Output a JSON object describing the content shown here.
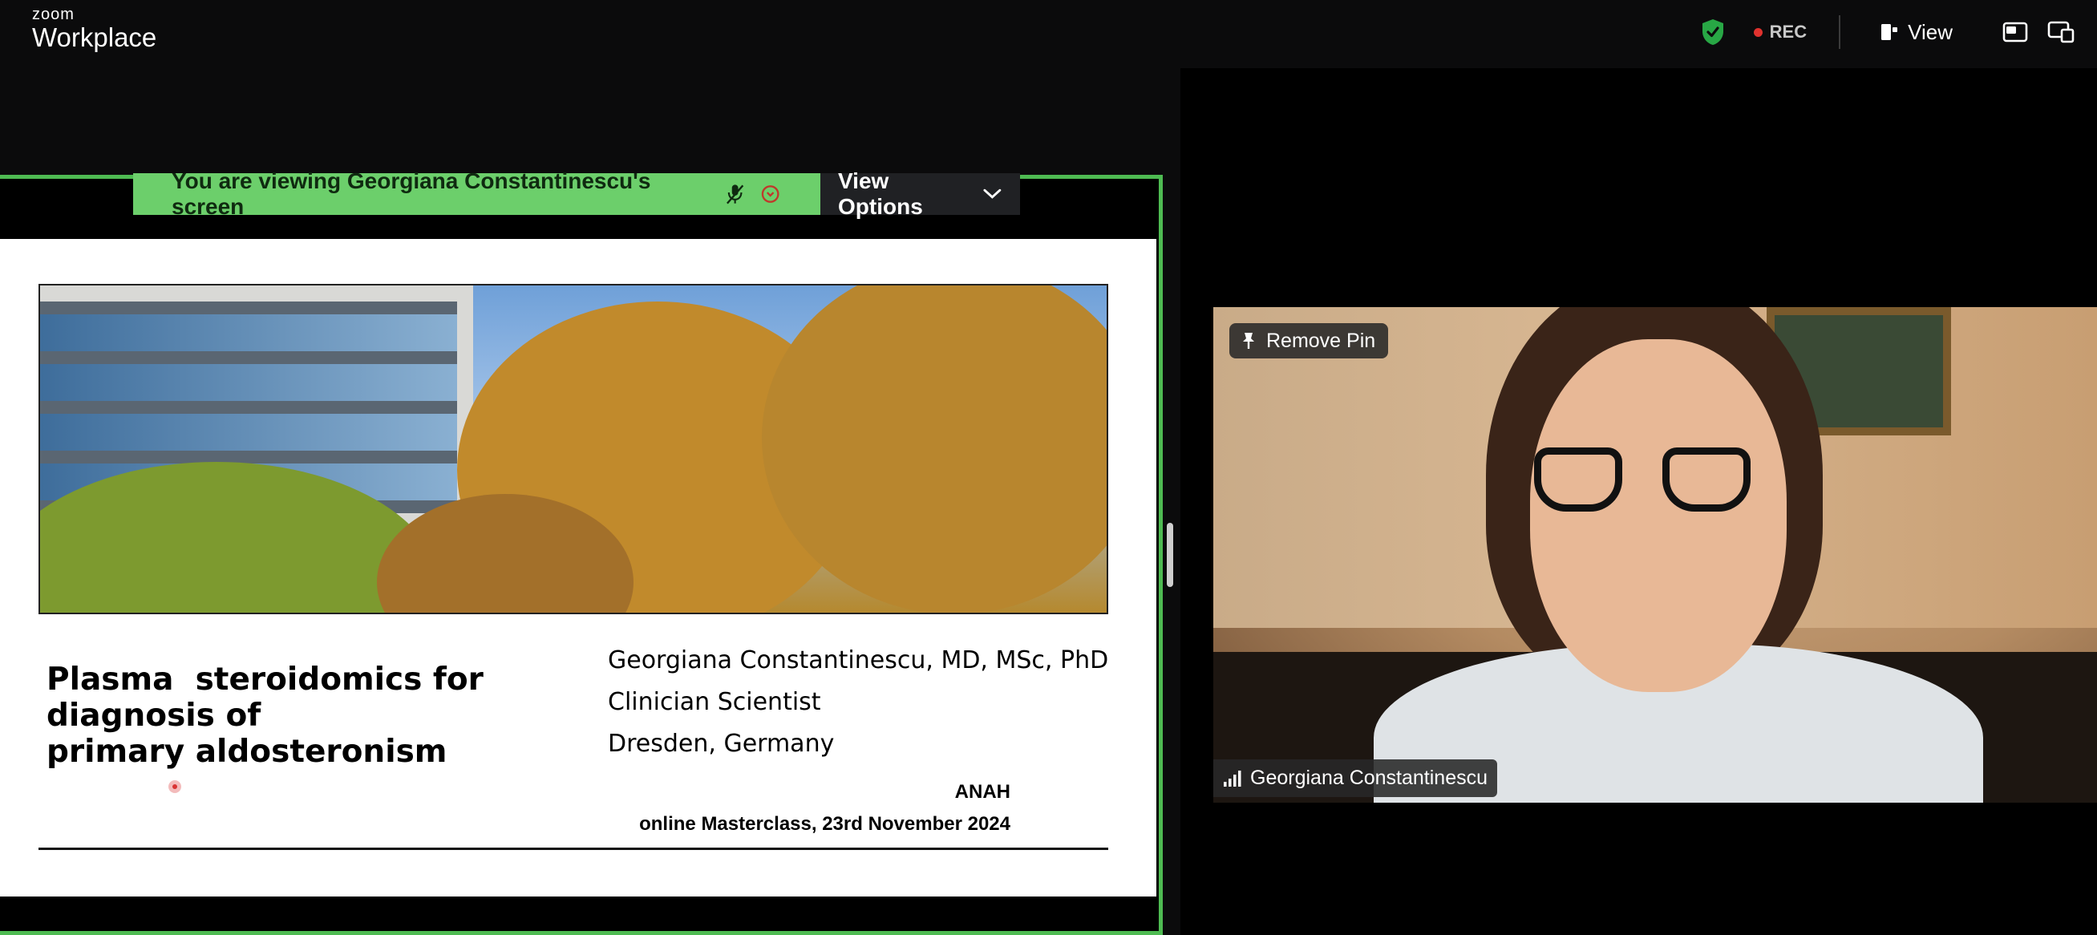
{
  "brand": {
    "small": "zoom",
    "name": "Workplace"
  },
  "topbar": {
    "rec_label": "REC",
    "view_label": "View",
    "colors": {
      "shield": "#28a745",
      "rec_dot": "#e0322e"
    }
  },
  "share_banner": {
    "viewing_text": "You are viewing  Georgiana Constantinescu's screen",
    "view_options_label": "View Options",
    "colors": {
      "banner": "#6ccf6b",
      "frame_border": "#4ebb52"
    }
  },
  "slide": {
    "title_lines": [
      "Plasma  steroidomics for",
      "diagnosis of",
      "primary aldosteronism"
    ],
    "author_lines": [
      "Georgiana Constantinescu, MD, MSc, PhD",
      "Clinician Scientist",
      "Dresden, Germany"
    ],
    "event_lines": [
      "ANAH",
      "online Masterclass, 23rd November 2024"
    ]
  },
  "video": {
    "remove_pin_label": "Remove Pin",
    "participant_name": "Georgiana Constantinescu"
  }
}
